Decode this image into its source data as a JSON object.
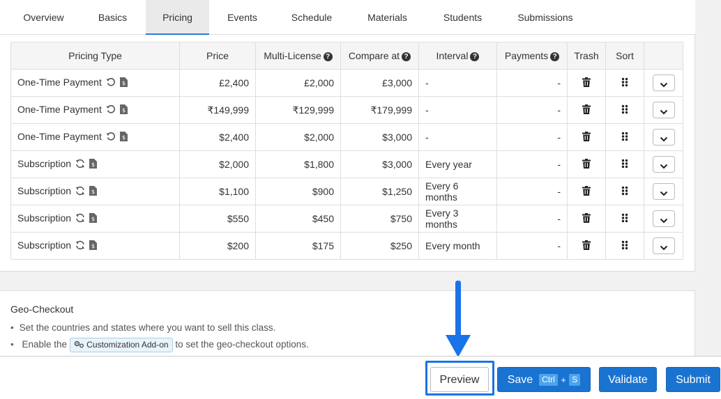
{
  "tabs": [
    {
      "label": "Overview",
      "active": false
    },
    {
      "label": "Basics",
      "active": false
    },
    {
      "label": "Pricing",
      "active": true
    },
    {
      "label": "Events",
      "active": false
    },
    {
      "label": "Schedule",
      "active": false
    },
    {
      "label": "Materials",
      "active": false
    },
    {
      "label": "Students",
      "active": false
    },
    {
      "label": "Submissions",
      "active": false
    }
  ],
  "pricing_table": {
    "headers": {
      "type": "Pricing Type",
      "price": "Price",
      "multi": "Multi-License",
      "compare": "Compare at",
      "interval": "Interval",
      "payments": "Payments",
      "trash": "Trash",
      "sort": "Sort",
      "help": "?"
    },
    "rows": [
      {
        "type": "One-Time Payment",
        "kind": "one-time",
        "price": "£2,400",
        "multi": "£2,000",
        "compare": "£3,000",
        "interval": "-",
        "payments": "-"
      },
      {
        "type": "One-Time Payment",
        "kind": "one-time",
        "price": "₹149,999",
        "multi": "₹129,999",
        "compare": "₹179,999",
        "interval": "-",
        "payments": "-"
      },
      {
        "type": "One-Time Payment",
        "kind": "one-time",
        "price": "$2,400",
        "multi": "$2,000",
        "compare": "$3,000",
        "interval": "-",
        "payments": "-"
      },
      {
        "type": "Subscription",
        "kind": "subscription",
        "price": "$2,000",
        "multi": "$1,800",
        "compare": "$3,000",
        "interval": "Every year",
        "payments": "-"
      },
      {
        "type": "Subscription",
        "kind": "subscription",
        "price": "$1,100",
        "multi": "$900",
        "compare": "$1,250",
        "interval": "Every 6 months",
        "payments": "-"
      },
      {
        "type": "Subscription",
        "kind": "subscription",
        "price": "$550",
        "multi": "$450",
        "compare": "$750",
        "interval": "Every 3 months",
        "payments": "-"
      },
      {
        "type": "Subscription",
        "kind": "subscription",
        "price": "$200",
        "multi": "$175",
        "compare": "$250",
        "interval": "Every month",
        "payments": "-"
      }
    ]
  },
  "geo": {
    "title": "Geo-Checkout",
    "bullet1": "Set the countries and states where you want to sell this class.",
    "bullet2_before": "Enable the",
    "addon_label": "Customization Add-on",
    "bullet2_after": "to set the geo-checkout options."
  },
  "footer": {
    "preview": "Preview",
    "save": "Save",
    "save_kbd1": "Ctrl",
    "save_plus": "+",
    "save_kbd2": "S",
    "validate": "Validate",
    "submit": "Submit"
  },
  "icons": {
    "one_time": "undo-icon",
    "subscription": "refresh-icon",
    "receipt": "dollar-file-icon",
    "trash": "trash-icon",
    "sort": "drag-handle-icon",
    "dropdown": "chevron-down-icon",
    "gears": "gears-icon",
    "annotation": "arrow-down-icon"
  },
  "colors": {
    "primary": "#1a73d1",
    "highlight": "#1a73e8",
    "active_tab_border": "#2c7be5",
    "kbd": "#4da3ec"
  }
}
